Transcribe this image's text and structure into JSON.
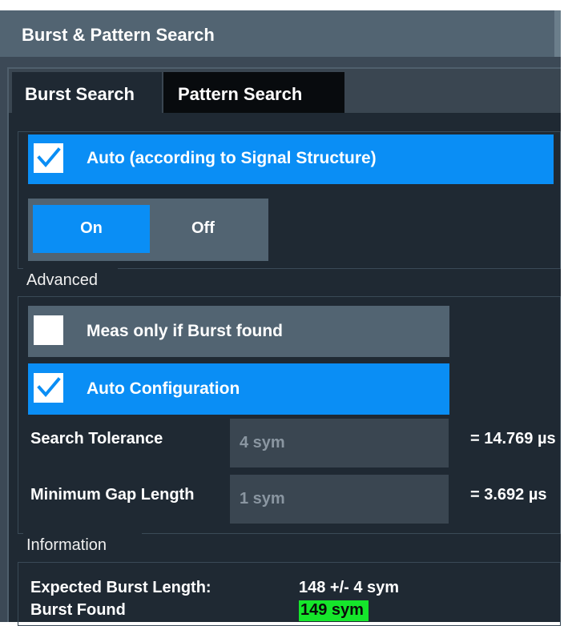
{
  "window": {
    "title": "Burst & Pattern Search"
  },
  "tabs": [
    {
      "label": "Burst Search",
      "active": true
    },
    {
      "label": "Pattern Search",
      "active": false
    }
  ],
  "burst_search": {
    "auto": {
      "label": "Auto (according to Signal Structure)",
      "checked": true
    },
    "toggle": {
      "on_label": "On",
      "off_label": "Off",
      "selected": "On"
    }
  },
  "advanced": {
    "section_label": "Advanced",
    "meas_only": {
      "label": "Meas only if Burst found",
      "checked": false
    },
    "auto_config": {
      "label": "Auto Configuration",
      "checked": true
    },
    "search_tolerance": {
      "label": "Search Tolerance",
      "value": "4 sym",
      "result": "= 14.769 µs"
    },
    "min_gap": {
      "label": "Minimum Gap Length",
      "value": "1 sym",
      "result": "= 3.692 µs"
    }
  },
  "information": {
    "section_label": "Information",
    "expected_label": "Expected Burst Length:",
    "expected_value": "148 +/- 4 sym",
    "found_label": "Burst Found",
    "found_value": "149 sym"
  },
  "colors": {
    "accent": "#0a8ef5",
    "found_highlight": "#15e62b",
    "panel_bg": "#1f2933",
    "titlebar_bg": "#526472"
  }
}
